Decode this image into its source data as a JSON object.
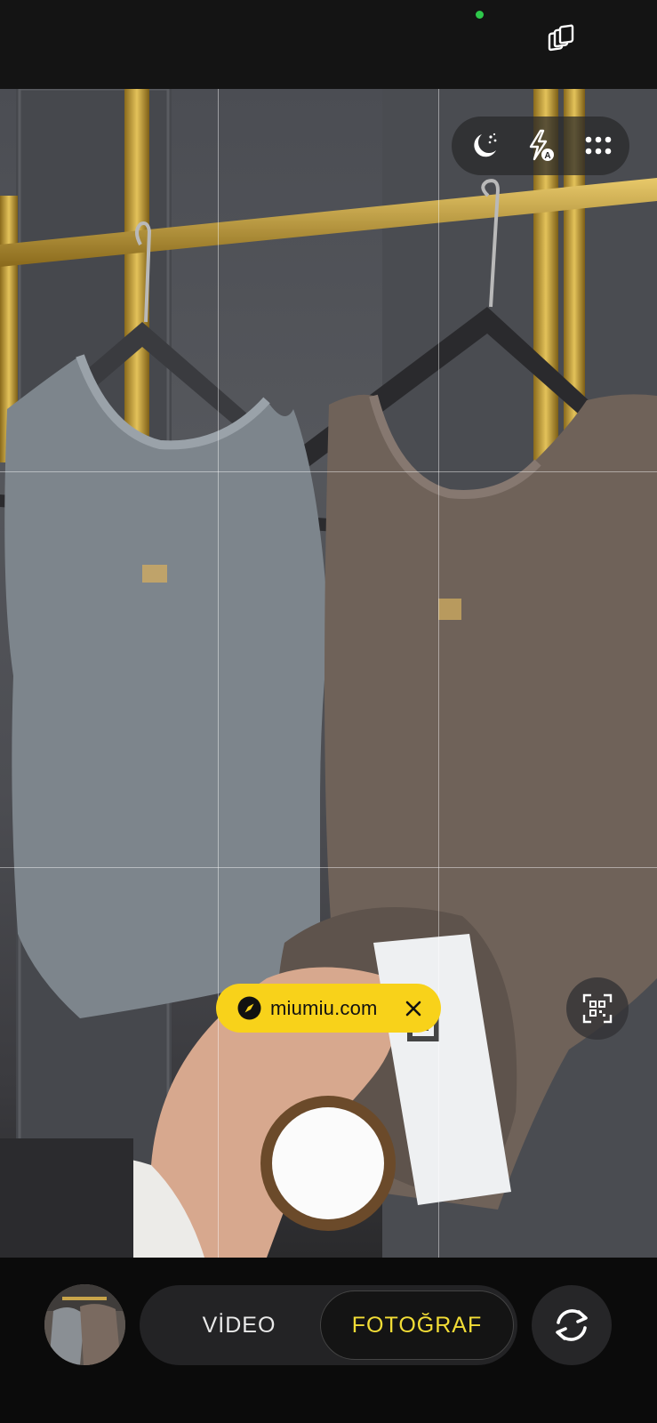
{
  "app": {
    "name": "Camera"
  },
  "status_bar": {
    "privacy_dot_color": "#2ec84b",
    "top_icon": "layers-icon"
  },
  "quick_settings": {
    "items": [
      {
        "name": "night-mode-icon"
      },
      {
        "name": "flash-auto-icon"
      },
      {
        "name": "more-options-icon"
      }
    ]
  },
  "scene_detection": {
    "link_chip": {
      "text": "miumiu.com",
      "icon": "compass-icon",
      "close_icon": "close-icon",
      "color": "#f8d21a"
    },
    "qr_scan_icon": "qr-scan-icon"
  },
  "shutter": {
    "ring_color": "#6b4a2a",
    "fill_color": "#fbfbfb"
  },
  "modes": {
    "items": [
      {
        "label": "VİDEO",
        "selected": false
      },
      {
        "label": "FOTOĞRAF",
        "selected": true
      }
    ],
    "selected_color": "#f2dd36"
  },
  "bottom_bar": {
    "switch_camera_icon": "switch-camera-icon",
    "gallery_thumbnail": "gallery-thumbnail"
  }
}
